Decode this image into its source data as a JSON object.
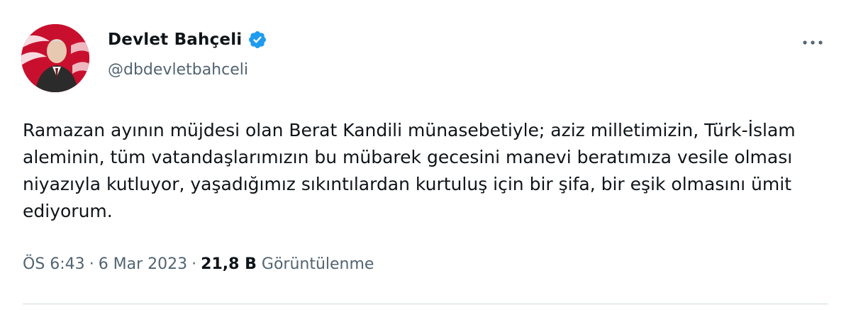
{
  "author": {
    "name": "Devlet Bahçeli",
    "handle": "@dbdevletbahceli",
    "verified": true,
    "verified_color": "#1d9bf0"
  },
  "menu": {
    "icon": "more-horizontal-icon"
  },
  "tweet": {
    "text": "Ramazan ayının müjdesi olan Berat Kandili münasebetiyle; aziz milletimizin, Türk-İslam aleminin, tüm vatandaşlarımızın bu mübarek gecesini manevi beratımıza vesile olması niyazıyla kutluyor, yaşadığımız sıkıntılardan kurtuluş için bir şifa, bir eşik olmasını ümit ediyorum."
  },
  "meta": {
    "time": "ÖS 6:43",
    "separator": "·",
    "date": "6 Mar 2023",
    "views_count": "21,8 B",
    "views_label": "Görüntülenme"
  },
  "colors": {
    "text_primary": "#0f1419",
    "text_secondary": "#536471",
    "divider": "#cfd9de",
    "avatar_bg": "#c8102e"
  }
}
